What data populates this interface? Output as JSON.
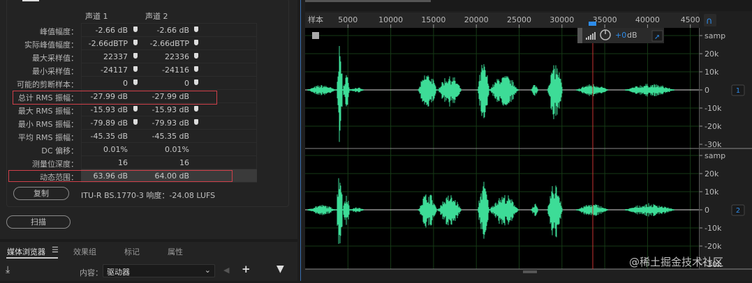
{
  "stats": {
    "col_headers": [
      "声道 1",
      "声道 2"
    ],
    "rows": [
      {
        "label": "峰值幅度：",
        "v1": "-2.66 dB",
        "v2": "-2.66 dB",
        "pin": true
      },
      {
        "label": "实际峰值幅度：",
        "v1": "-2.66dBTP",
        "v2": "-2.66dBTP",
        "pin": true
      },
      {
        "label": "最大采样值：",
        "v1": "22337",
        "v2": "22336",
        "pin": true
      },
      {
        "label": "最小采样值：",
        "v1": "-24117",
        "v2": "-24116",
        "pin": true
      },
      {
        "label": "可能的剪断样本：",
        "v1": "0",
        "v2": "0",
        "pin": true
      },
      {
        "label": "总计 RMS 振幅：",
        "v1": "-27.99 dB",
        "v2": "-27.99 dB",
        "pin": false
      },
      {
        "label": "最大 RMS 振幅：",
        "v1": "-15.93 dB",
        "v2": "-15.93 dB",
        "pin": true
      },
      {
        "label": "最小 RMS 振幅：",
        "v1": "-79.89 dB",
        "v2": "-79.93 dB",
        "pin": true
      },
      {
        "label": "平均 RMS 振幅：",
        "v1": "-45.35 dB",
        "v2": "-45.35 dB",
        "pin": false
      },
      {
        "label": "DC 偏移：",
        "v1": "0.01%",
        "v2": "0.01%",
        "pin": false
      },
      {
        "label": "测量位深度：",
        "v1": "16",
        "v2": "16",
        "pin": false
      },
      {
        "label": "动态范围：",
        "v1": "63.96 dB",
        "v2": "64.00 dB",
        "pin": false
      }
    ],
    "copy_label": "复制",
    "loudness": "ITU-R BS.1770-3 响度：-24.08 LUFS",
    "scan_label": "扫描"
  },
  "bottom": {
    "tabs": [
      "媒体浏览器",
      "效果组",
      "标记",
      "属性"
    ],
    "content_label": "内容：",
    "content_value": "驱动器"
  },
  "editor": {
    "ruler_unit": "样本",
    "ruler_ticks": [
      "5000",
      "10000",
      "15000",
      "20000",
      "25000",
      "30000",
      "35000",
      "40000",
      "4500"
    ],
    "gain": "+0",
    "gain_unit": "dB",
    "channel_axis": [
      "samp",
      "20k",
      "10k",
      "0",
      "-10k",
      "-20k",
      "-30k"
    ],
    "channel_badges": [
      "1",
      "2"
    ]
  },
  "watermark": "@稀土掘金技术社区",
  "colors": {
    "wave": "#3ddc97",
    "playhead": "#c83232",
    "accent": "#2d8ceb"
  }
}
